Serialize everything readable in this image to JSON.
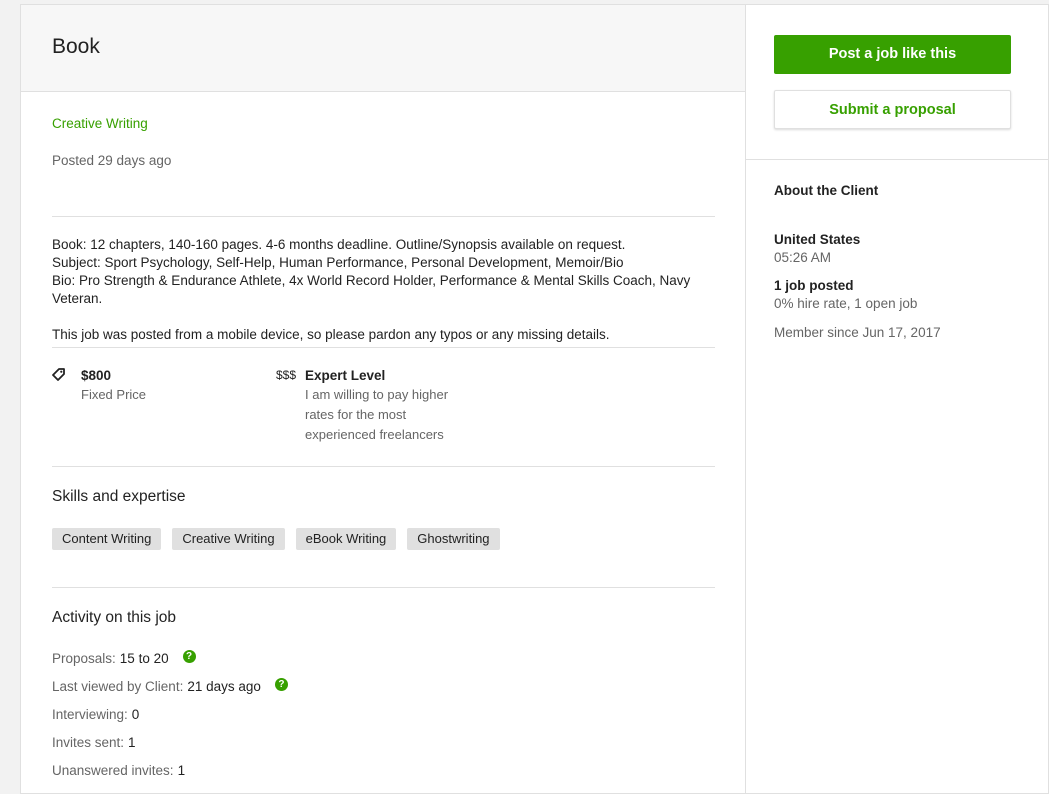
{
  "job": {
    "title": "Book",
    "category": "Creative Writing",
    "posted": "Posted 29 days ago",
    "description": [
      "Book: 12 chapters, 140-160 pages. 4-6 months deadline. Outline/Synopsis available on request.",
      "Subject: Sport Psychology, Self-Help, Human Performance, Personal Development, Memoir/Bio",
      "Bio: Pro Strength & Endurance Athlete, 4x World Record Holder, Performance & Mental Skills Coach, Navy Veteran."
    ],
    "mobile_note": "This job was posted from a mobile device, so please pardon any typos or any missing details."
  },
  "price": {
    "icon": "tag-icon",
    "amount": "$800",
    "type": "Fixed Price"
  },
  "level": {
    "icon_text": "$$$",
    "title": "Expert Level",
    "desc_lines": [
      "I am willing to pay higher",
      "rates for the most",
      "experienced freelancers"
    ]
  },
  "skills": {
    "heading": "Skills and expertise",
    "items": [
      "Content Writing",
      "Creative Writing",
      "eBook Writing",
      "Ghostwriting"
    ]
  },
  "activity": {
    "heading": "Activity on this job",
    "rows": [
      {
        "label": "Proposals:",
        "value": "15 to 20",
        "help": true
      },
      {
        "label": "Last viewed by Client:",
        "value": "21 days ago",
        "help": true
      },
      {
        "label": "Interviewing:",
        "value": "0",
        "help": false
      },
      {
        "label": "Invites sent:",
        "value": "1",
        "help": false
      },
      {
        "label": "Unanswered invites:",
        "value": "1",
        "help": false
      }
    ]
  },
  "sidebar": {
    "post_button": "Post a job like this",
    "submit_button": "Submit a proposal",
    "about_heading": "About the Client",
    "country": "United States",
    "time": "05:26 AM",
    "jobs_posted": "1 job posted",
    "hire_rate": "0% hire rate, 1 open job",
    "member_since": "Member since Jun 17, 2017"
  },
  "colors": {
    "accent": "#37a000",
    "muted": "#656565",
    "border": "#e0e0e0"
  }
}
